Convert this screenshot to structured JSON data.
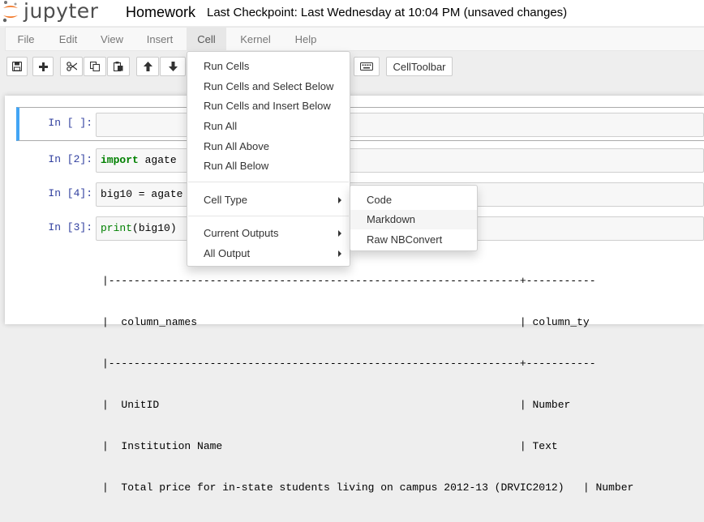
{
  "header": {
    "logo_text": "jupyter",
    "notebook_name": "Homework",
    "checkpoint": "Last Checkpoint: Last Wednesday at 10:04 PM (unsaved changes)"
  },
  "menubar": {
    "items": [
      "File",
      "Edit",
      "View",
      "Insert",
      "Cell",
      "Kernel",
      "Help"
    ],
    "active": "Cell"
  },
  "toolbar": {
    "celltoolbar_label": "CellToolbar",
    "icons": [
      "save-icon",
      "plus-icon",
      "cut-icon",
      "copy-icon",
      "paste-icon",
      "arrow-up-icon",
      "arrow-down-icon",
      "keyboard-icon"
    ]
  },
  "cells": [
    {
      "prompt": "In [ ]:",
      "code": ""
    },
    {
      "prompt": "In [2]:",
      "code_kw": "import",
      "code_rest": " agate"
    },
    {
      "prompt": "In [4]:",
      "code": "big10 = agate"
    },
    {
      "prompt": "In [3]:",
      "code_bi": "print",
      "code_rest": "(big10)"
    }
  ],
  "output": {
    "lines": [
      "|-----------------------------------------------------------------+-----------",
      "|  column_names                                                   | column_ty",
      "|-----------------------------------------------------------------+-----------",
      "|  UnitID                                                         | Number",
      "|  Institution Name                                               | Text",
      "|  Total price for in-state students living on campus 2012-13 (DRVIC2012)   | Number"
    ]
  },
  "cell_menu": {
    "items": [
      "Run Cells",
      "Run Cells and Select Below",
      "Run Cells and Insert Below",
      "Run All",
      "Run All Above",
      "Run All Below",
      "Cell Type",
      "Current Outputs",
      "All Output"
    ]
  },
  "cell_type_menu": {
    "items": [
      "Code",
      "Markdown",
      "Raw NBConvert"
    ],
    "hovered": "Markdown"
  }
}
